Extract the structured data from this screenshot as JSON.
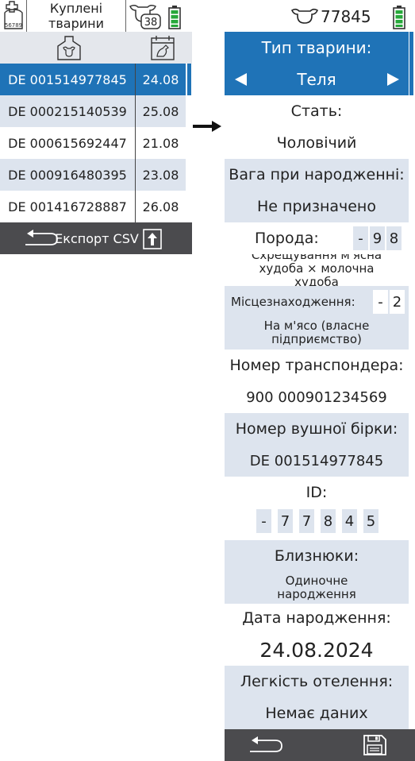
{
  "left_panel": {
    "title": "Куплені тварини",
    "tag_icon_text": "56789",
    "cow_count": "38",
    "rows": [
      {
        "id": "DE 001514977845",
        "date": "24.08"
      },
      {
        "id": "DE 000215140539",
        "date": "25.08"
      },
      {
        "id": "DE 000615692447",
        "date": "21.08"
      },
      {
        "id": "DE 000916480395",
        "date": "23.08"
      },
      {
        "id": "DE 001416728887",
        "date": "26.08"
      }
    ],
    "export_label": "Експорт CSV"
  },
  "right_panel": {
    "header_id": "77845",
    "animal_type_label": "Тип тварини:",
    "animal_type_value": "Теля",
    "sex_label": "Стать:",
    "sex_value": "Чоловічий",
    "birth_weight_label": "Вага при народженні:",
    "birth_weight_value": "Не призначено",
    "breed_label": "Порода:",
    "breed_digits": [
      "-",
      "9",
      "8"
    ],
    "breed_text": "Схрещування м'ясна худоба × молочна худоба",
    "location_label": "Місцезнаходження:",
    "location_digits": [
      "-",
      "2"
    ],
    "location_text": "На м'ясо (власне підприємство)",
    "transponder_label": "Номер транспондера:",
    "transponder_value": "900 000901234569",
    "eartag_label": "Номер вушної бірки:",
    "eartag_value": "DE 001514977845",
    "id_label": "ID:",
    "id_digits": [
      "-",
      "7",
      "7",
      "8",
      "4",
      "5"
    ],
    "twins_label": "Близнюки:",
    "twins_value": "Одиночне народження",
    "birth_date_label": "Дата народження:",
    "birth_date_value": "24.08.2024",
    "calving_label": "Легкість отелення:",
    "calving_value": "Немає даних"
  },
  "colors": {
    "accent_blue": "#1f73b7",
    "row_alt": "#dde4ee",
    "footer_dark": "#4b4b4e",
    "battery_green": "#27a83a"
  }
}
